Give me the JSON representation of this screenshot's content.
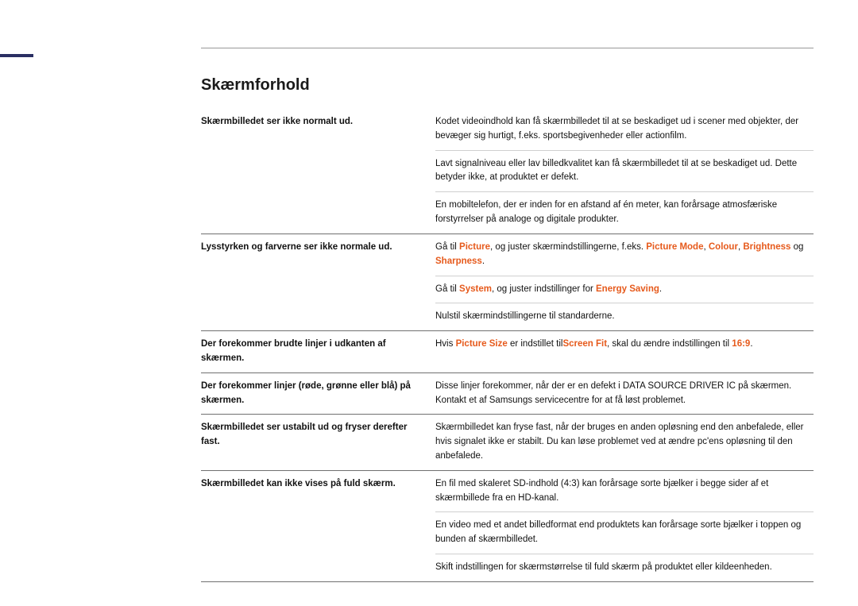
{
  "heading": "Skærmforhold",
  "rows": [
    {
      "left": "Skærmbilledet ser ikke normalt ud.",
      "cells": [
        {
          "segs": [
            {
              "t": "Kodet videoindhold kan få skærmbilledet til at se beskadiget ud i scener med objekter, der bevæger sig hurtigt, f.eks. sportsbegivenheder eller actionfilm."
            }
          ]
        },
        {
          "segs": [
            {
              "t": "Lavt signalniveau eller lav billedkvalitet kan få skærmbilledet til at se beskadiget ud. Dette betyder ikke, at produktet er defekt."
            }
          ]
        },
        {
          "segs": [
            {
              "t": "En mobiltelefon, der er inden for en afstand af én meter, kan forårsage atmosfæriske forstyrrelser på analoge og digitale produkter."
            }
          ]
        }
      ]
    },
    {
      "left": "Lysstyrken og farverne ser ikke normale ud.",
      "cells": [
        {
          "segs": [
            {
              "t": "Gå til "
            },
            {
              "t": "Picture",
              "hl": true
            },
            {
              "t": ", og juster skærmindstillingerne, f.eks. "
            },
            {
              "t": "Picture Mode",
              "hl": true
            },
            {
              "t": ", "
            },
            {
              "t": "Colour",
              "hl": true
            },
            {
              "t": ", "
            },
            {
              "t": "Brightness",
              "hl": true
            },
            {
              "t": " og "
            },
            {
              "t": "Sharpness",
              "hl": true
            },
            {
              "t": "."
            }
          ]
        },
        {
          "segs": [
            {
              "t": "Gå til "
            },
            {
              "t": "System",
              "hl": true
            },
            {
              "t": ", og juster indstillinger for "
            },
            {
              "t": "Energy Saving",
              "hl": true
            },
            {
              "t": "."
            }
          ]
        },
        {
          "segs": [
            {
              "t": "Nulstil skærmindstillingerne til standarderne."
            }
          ]
        }
      ]
    },
    {
      "left": "Der forekommer brudte linjer i udkanten af skærmen.",
      "cells": [
        {
          "segs": [
            {
              "t": "Hvis "
            },
            {
              "t": "Picture Size",
              "hl": true
            },
            {
              "t": " er indstillet til"
            },
            {
              "t": "Screen Fit",
              "hl": true
            },
            {
              "t": ", skal du ændre indstillingen til "
            },
            {
              "t": "16:9",
              "hl": true
            },
            {
              "t": "."
            }
          ]
        }
      ]
    },
    {
      "left": "Der forekommer linjer (røde, grønne eller blå) på skærmen.",
      "cells": [
        {
          "segs": [
            {
              "t": "Disse linjer forekommer, når der er en defekt i DATA SOURCE DRIVER IC på skærmen. Kontakt et af Samsungs servicecentre for at få løst problemet."
            }
          ]
        }
      ]
    },
    {
      "left": "Skærmbilledet ser ustabilt ud og fryser derefter fast.",
      "cells": [
        {
          "segs": [
            {
              "t": "Skærmbilledet kan fryse fast, når der bruges en anden opløsning end den anbefalede, eller hvis signalet ikke er stabilt. Du kan løse problemet ved at ændre pc'ens opløsning til den anbefalede."
            }
          ]
        }
      ]
    },
    {
      "left": "Skærmbilledet kan ikke vises på fuld skærm.",
      "cells": [
        {
          "segs": [
            {
              "t": "En fil med skaleret SD-indhold (4:3) kan forårsage sorte bjælker i begge sider af et skærmbillede fra en HD-kanal."
            }
          ]
        },
        {
          "segs": [
            {
              "t": "En video med et andet billedformat end produktets kan forårsage sorte bjælker i toppen og bunden af skærmbilledet."
            }
          ]
        },
        {
          "segs": [
            {
              "t": "Skift indstillingen for skærmstørrelse til fuld skærm på produktet eller kildeenheden."
            }
          ]
        }
      ]
    }
  ]
}
